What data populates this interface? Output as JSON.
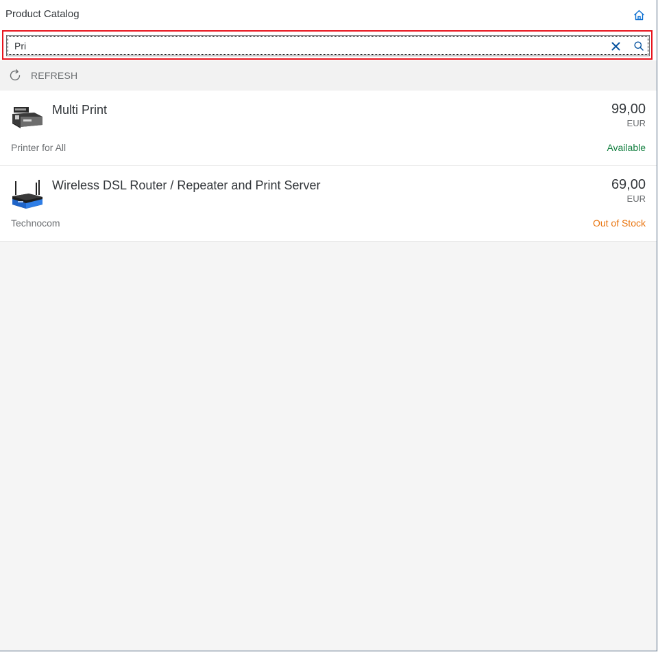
{
  "header": {
    "title": "Product Catalog",
    "home_icon": "home-icon"
  },
  "search": {
    "value": "Pri",
    "placeholder": "",
    "clear_icon": "clear-icon",
    "search_icon": "search-icon"
  },
  "toolbar": {
    "refresh_label": "REFRESH",
    "refresh_icon": "refresh-icon"
  },
  "products": [
    {
      "name": "Multi Print",
      "supplier": "Printer for All",
      "price": "99,00",
      "currency": "EUR",
      "status": "Available",
      "image_icon": "printer-image"
    },
    {
      "name": "Wireless DSL Router / Repeater and Print Server",
      "supplier": "Technocom",
      "price": "69,00",
      "currency": "EUR",
      "status": "Out of Stock",
      "image_icon": "router-image"
    }
  ],
  "colors": {
    "highlight_border": "#e8131c",
    "status_available": "#107e3e",
    "status_out_of_stock": "#e9730c",
    "accent": "#0a6ed1"
  }
}
